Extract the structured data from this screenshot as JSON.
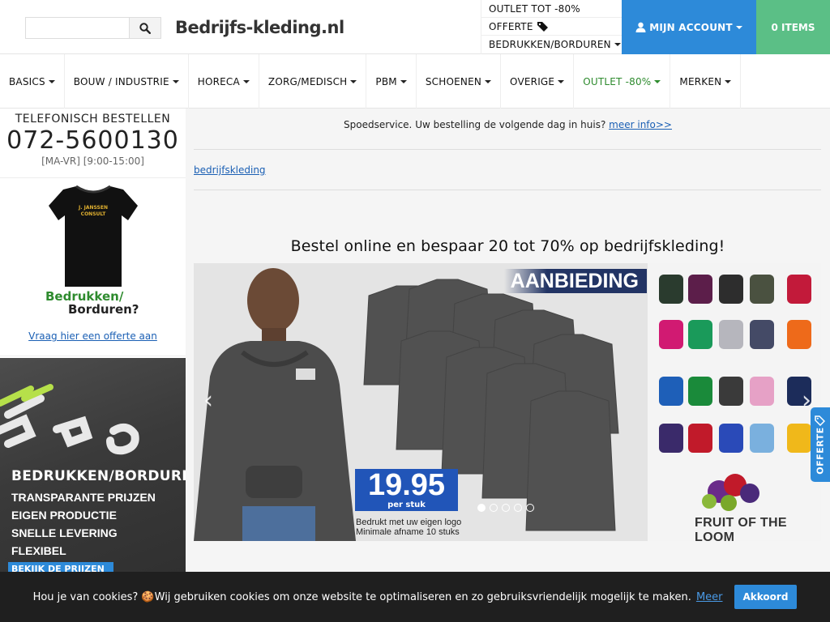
{
  "header": {
    "search_placeholder": "",
    "logo_main": "Bedrijfs",
    "logo_sep": "-",
    "logo_rest": "kleding.nl",
    "top_links": {
      "outlet": "OUTLET TOT -80%",
      "offerte": "OFFERTE",
      "bedrukken": "BEDRUKKEN/BORDUREN"
    },
    "account_label": "MIJN ACCOUNT",
    "cart_label": "0 ITEMS",
    "colors": {
      "account": "#2d8ad9",
      "cart": "#5bbf86"
    }
  },
  "nav": {
    "items": [
      {
        "label": "BASICS"
      },
      {
        "label": "BOUW / INDUSTRIE"
      },
      {
        "label": "HORECA"
      },
      {
        "label": "ZORG/MEDISCH"
      },
      {
        "label": "PBM"
      },
      {
        "label": "SCHOENEN"
      },
      {
        "label": "OVERIGE"
      },
      {
        "label": "OUTLET -80%"
      },
      {
        "label": "MERKEN"
      }
    ],
    "outlet_color": "#2e8b2e"
  },
  "sidebar": {
    "phone_title": "TELEFONISCH BESTELLEN",
    "phone_number": "072-5600130",
    "phone_hours": "[MA-VR] [9:00-15:00]",
    "shirt_caption_1": "Bedrukken/",
    "shirt_caption_2": "Borduren?",
    "offer_link": "Vraag hier een offerte aan",
    "banner": {
      "heading": "BEDRUKKEN/BORDUREN",
      "bullets": [
        "TRANSPARANTE PRIJZEN",
        "EIGEN PRODUCTIE",
        "SNELLE LEVERING",
        "FLEXIBEL"
      ],
      "cta": "BEKIJK DE PRIJZEN"
    }
  },
  "main": {
    "spoed_text": "Spoedservice. Uw bestelling de volgende dag in huis?",
    "spoed_link": "meer info>>",
    "breadcrumb": "bedrijfskleding",
    "headline": "Bestel online en bespaar 20 tot 70% op bedrijfskleding!",
    "carousel": {
      "badge": "AANBIEDING",
      "price": "19.95",
      "price_unit": "per stuk",
      "promo_line1": "Bedrukt met uw eigen logo",
      "promo_line2": "Minimale afname 10 stuks",
      "brand": "FRUIT OF THE LOOM",
      "slides_total": 5,
      "active_slide": 1
    }
  },
  "offerte_tab": {
    "label": "OFFERTE"
  },
  "cookie": {
    "text": "Hou je van cookies? 🍪Wij gebruiken cookies om onze website te optimaliseren en zo gebruiksvriendelijk mogelijk te maken.",
    "more": "Meer",
    "accept": "Akkoord"
  }
}
